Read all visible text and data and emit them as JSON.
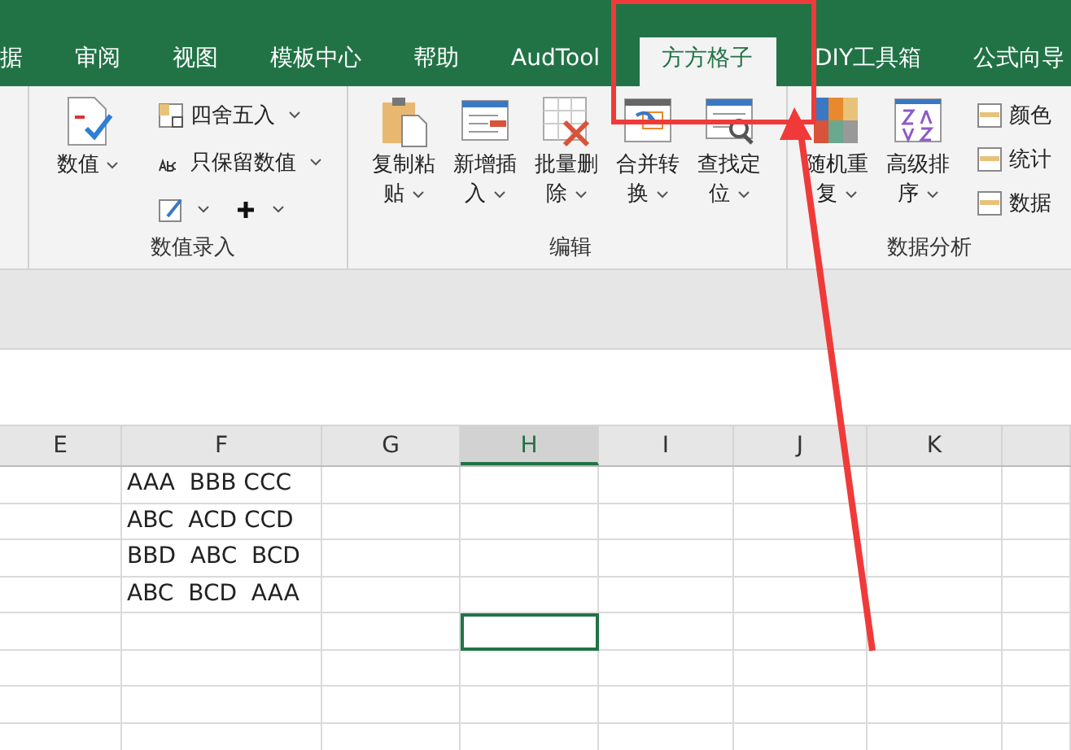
{
  "tabs": [
    {
      "label": "据",
      "selected": false
    },
    {
      "label": "审阅",
      "selected": false
    },
    {
      "label": "视图",
      "selected": false
    },
    {
      "label": "模板中心",
      "selected": false
    },
    {
      "label": "帮助",
      "selected": false
    },
    {
      "label": "AudTool",
      "selected": false
    },
    {
      "label": "方方格子",
      "selected": true
    },
    {
      "label": "DIY工具箱",
      "selected": false
    },
    {
      "label": "公式向导",
      "selected": false
    }
  ],
  "ribbon_groups": [
    {
      "label": "数值录入",
      "items": [
        {
          "kind": "large",
          "label": "数值"
        },
        {
          "kind": "small",
          "label": "四舍五入"
        },
        {
          "kind": "small",
          "label": "只保留数值"
        },
        {
          "kind": "pair"
        }
      ]
    },
    {
      "label": "编辑",
      "items": [
        {
          "kind": "large",
          "label": "复制粘贴"
        },
        {
          "kind": "large",
          "label": "新增插入"
        },
        {
          "kind": "large",
          "label": "批量删除"
        },
        {
          "kind": "large",
          "label": "合并转换"
        },
        {
          "kind": "large",
          "label": "查找定位"
        }
      ]
    },
    {
      "label": "数据分析",
      "items": [
        {
          "kind": "large",
          "label": "随机重复"
        },
        {
          "kind": "large",
          "label": "高级排序"
        },
        {
          "kind": "stack",
          "labels": [
            "颜色",
            "统计",
            "数据"
          ]
        }
      ]
    }
  ],
  "sheet": {
    "columns": [
      {
        "label": "E",
        "selected": false
      },
      {
        "label": "F",
        "selected": false,
        "cells": [
          "AAA  BBB CCC",
          "ABC  ACD CCD",
          "BBD  ABC  BCD",
          "ABC  BCD  AAA"
        ]
      },
      {
        "label": "G",
        "selected": false
      },
      {
        "label": "H",
        "selected": true
      },
      {
        "label": "I",
        "selected": false
      },
      {
        "label": "J",
        "selected": false
      },
      {
        "label": "K",
        "selected": false
      }
    ],
    "rows": [
      {
        "selected": false
      },
      {
        "selected": false
      },
      {
        "selected": false
      },
      {
        "selected": false
      },
      {
        "selected": true
      },
      {
        "selected": false
      },
      {
        "selected": false
      },
      {
        "selected": false
      }
    ]
  }
}
